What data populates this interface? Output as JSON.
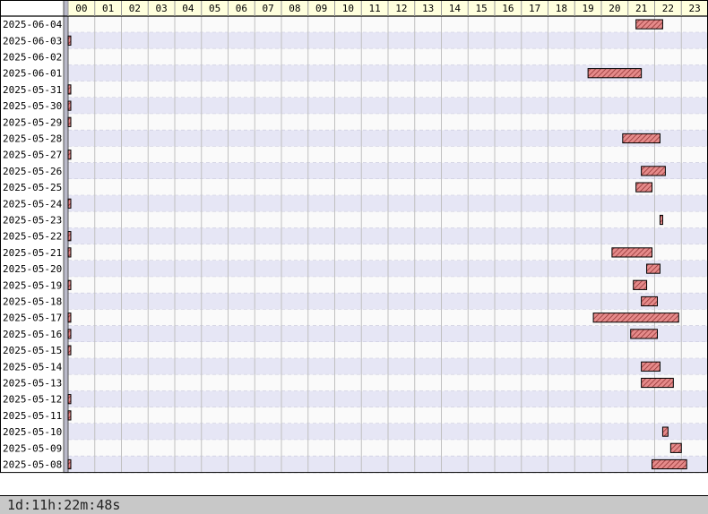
{
  "chart_data": {
    "type": "gantt",
    "title": "",
    "hours": [
      "00",
      "01",
      "02",
      "03",
      "04",
      "05",
      "06",
      "07",
      "08",
      "09",
      "10",
      "11",
      "12",
      "13",
      "14",
      "15",
      "16",
      "17",
      "18",
      "19",
      "20",
      "21",
      "22",
      "23"
    ],
    "rows": [
      {
        "date": "2025-06-04",
        "segments": [
          [
            21.3,
            22.3
          ]
        ]
      },
      {
        "date": "2025-06-03",
        "segments": [
          [
            0,
            0.05
          ]
        ]
      },
      {
        "date": "2025-06-02",
        "segments": []
      },
      {
        "date": "2025-06-01",
        "segments": [
          [
            19.5,
            21.5
          ]
        ]
      },
      {
        "date": "2025-05-31",
        "segments": [
          [
            0,
            0.05
          ]
        ]
      },
      {
        "date": "2025-05-30",
        "segments": [
          [
            0,
            0.05
          ]
        ]
      },
      {
        "date": "2025-05-29",
        "segments": [
          [
            0,
            0.05
          ]
        ]
      },
      {
        "date": "2025-05-28",
        "segments": [
          [
            20.8,
            22.2
          ]
        ]
      },
      {
        "date": "2025-05-27",
        "segments": [
          [
            0,
            0.05
          ]
        ]
      },
      {
        "date": "2025-05-26",
        "segments": [
          [
            21.5,
            22.4
          ]
        ]
      },
      {
        "date": "2025-05-25",
        "segments": [
          [
            21.3,
            21.9
          ]
        ]
      },
      {
        "date": "2025-05-24",
        "segments": [
          [
            0,
            0.05
          ]
        ]
      },
      {
        "date": "2025-05-23",
        "segments": [
          [
            22.2,
            22.3
          ]
        ]
      },
      {
        "date": "2025-05-22",
        "segments": [
          [
            0,
            0.05
          ]
        ]
      },
      {
        "date": "2025-05-21",
        "segments": [
          [
            0,
            0.05
          ],
          [
            20.4,
            21.9
          ]
        ]
      },
      {
        "date": "2025-05-20",
        "segments": [
          [
            21.7,
            22.2
          ]
        ]
      },
      {
        "date": "2025-05-19",
        "segments": [
          [
            0,
            0.05
          ],
          [
            21.2,
            21.7
          ]
        ]
      },
      {
        "date": "2025-05-18",
        "segments": [
          [
            21.5,
            22.1
          ]
        ]
      },
      {
        "date": "2025-05-17",
        "segments": [
          [
            0,
            0.05
          ],
          [
            19.7,
            22.9
          ]
        ]
      },
      {
        "date": "2025-05-16",
        "segments": [
          [
            0,
            0.05
          ],
          [
            21.1,
            22.1
          ]
        ]
      },
      {
        "date": "2025-05-15",
        "segments": [
          [
            0,
            0.05
          ]
        ]
      },
      {
        "date": "2025-05-14",
        "segments": [
          [
            21.5,
            22.2
          ]
        ]
      },
      {
        "date": "2025-05-13",
        "segments": [
          [
            21.5,
            22.7
          ]
        ]
      },
      {
        "date": "2025-05-12",
        "segments": [
          [
            0,
            0.05
          ]
        ]
      },
      {
        "date": "2025-05-11",
        "segments": [
          [
            0,
            0.05
          ]
        ]
      },
      {
        "date": "2025-05-10",
        "segments": [
          [
            22.3,
            22.5
          ]
        ]
      },
      {
        "date": "2025-05-09",
        "segments": [
          [
            22.6,
            23.0
          ]
        ]
      },
      {
        "date": "2025-05-08",
        "segments": [
          [
            0,
            0.05
          ],
          [
            21.9,
            23.2
          ]
        ]
      }
    ],
    "colors": {
      "bar": "#e07a7a",
      "bar_hatch": "#7a1f1f",
      "row_alt": "#e6e6f5",
      "row": "#fafafa",
      "header_bg": "#ffffdd"
    },
    "grid": true
  },
  "footer": {
    "total": "1d:11h:22m:48s"
  }
}
